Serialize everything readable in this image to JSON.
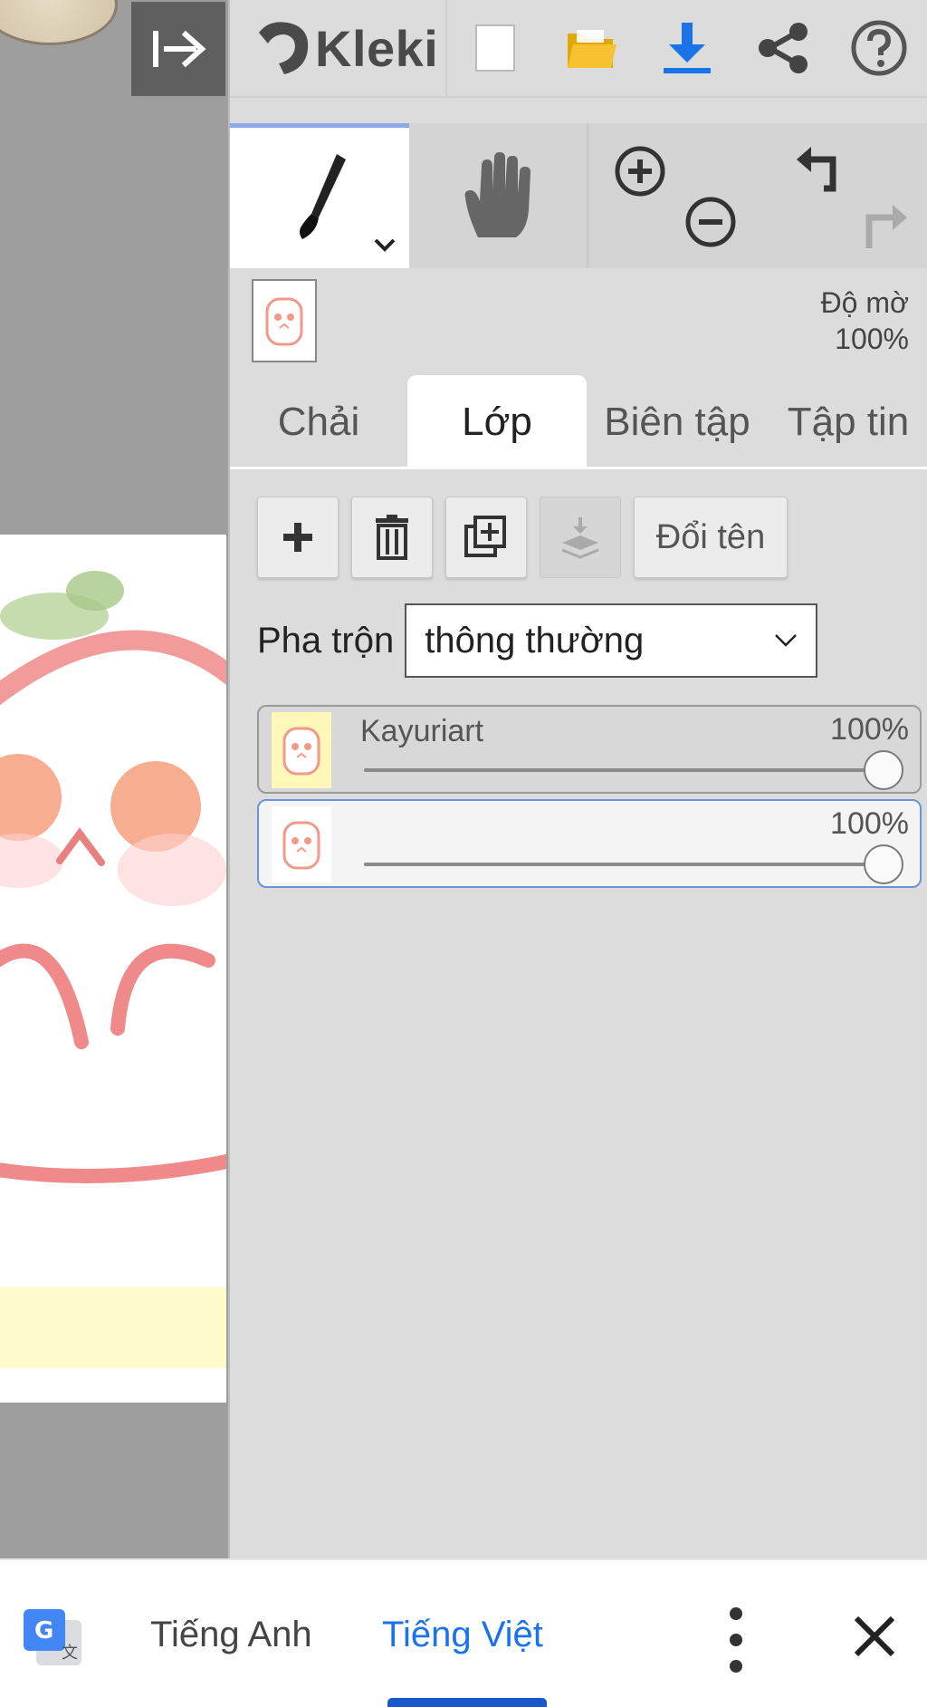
{
  "app": {
    "name": "Kleki"
  },
  "toolbar": {
    "items": [
      "collapse-icon",
      "kleki-logo",
      "new-file-icon",
      "open-folder-icon",
      "download-icon",
      "share-icon",
      "help-icon"
    ],
    "accent": "#1a73e8"
  },
  "tools": {
    "brush": "brush-icon",
    "hand": "hand-icon",
    "zoom_in": "zoom-in-icon",
    "zoom_out": "zoom-out-icon",
    "undo": "undo-icon",
    "redo": "redo-icon"
  },
  "status": {
    "opacity_label": "Độ mờ",
    "opacity_value": "100%"
  },
  "tabs": [
    {
      "label": "Chải",
      "active": false
    },
    {
      "label": "Lớp",
      "active": true
    },
    {
      "label": "Biên tập",
      "active": false
    },
    {
      "label": "Tập tin",
      "active": false
    }
  ],
  "actions": {
    "add": "add-layer-icon",
    "delete": "trash-icon",
    "duplicate": "duplicate-icon",
    "merge": "merge-down-icon",
    "rename_label": "Đổi tên"
  },
  "blend": {
    "label": "Pha trộn",
    "value": "thông thường"
  },
  "layers": [
    {
      "name": "Kayuriart",
      "opacity": "100%",
      "opacity_fraction": 1.0,
      "selected": false
    },
    {
      "name": "",
      "opacity": "100%",
      "opacity_fraction": 1.0,
      "selected": true
    }
  ],
  "translate_bar": {
    "source_lang": "Tiếng Anh",
    "target_lang": "Tiếng Việt",
    "active_color": "#1a73e8"
  }
}
